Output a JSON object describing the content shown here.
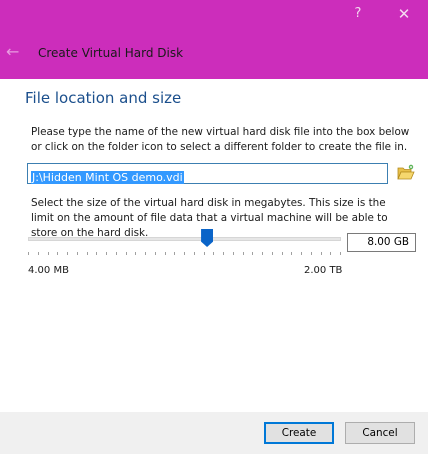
{
  "titlebar": {
    "help_glyph": "?",
    "close_glyph": "✕",
    "back_glyph": "←",
    "title": "Create Virtual Hard Disk",
    "color": "#cc2dbb"
  },
  "section": {
    "title": "File location and size"
  },
  "file_location": {
    "description": "Please type the name of the new virtual hard disk file into the box below or click on the folder icon to select a different folder to create the file in.",
    "path_value": "J:\\Hidden Mint OS demo.vdi",
    "folder_icon": "folder-open-icon"
  },
  "size": {
    "description": "Select the size of the virtual hard disk in megabytes. This size is the limit on the amount of file data that a virtual machine will be able to store on the hard disk.",
    "value": "8.00 GB",
    "slider_fraction": 0.575,
    "min_label": "4.00 MB",
    "max_label": "2.00 TB",
    "accent": "#0a64c8"
  },
  "buttons": {
    "create": "Create",
    "cancel": "Cancel",
    "default_border": "#0078d7"
  }
}
